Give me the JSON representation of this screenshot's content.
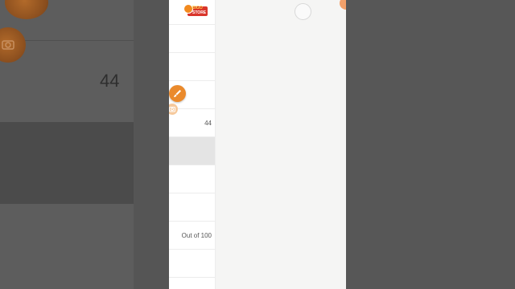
{
  "store_badge": {
    "line1": "BIGO",
    "line2": "STORE"
  },
  "rows": [
    {
      "value": ""
    },
    {
      "value": ""
    },
    {
      "value": ""
    },
    {
      "value": "44"
    },
    {
      "value": ""
    },
    {
      "value": ""
    },
    {
      "value": ""
    },
    {
      "value": "Out of 100"
    },
    {
      "value": ""
    }
  ],
  "background": {
    "value": "44"
  },
  "icons": {
    "brush": "paint-brush-icon",
    "camera": "camera-icon",
    "loading": "loading-spinner-icon"
  },
  "colors": {
    "accent": "#ea8a2c",
    "badge": "#d9352b"
  }
}
